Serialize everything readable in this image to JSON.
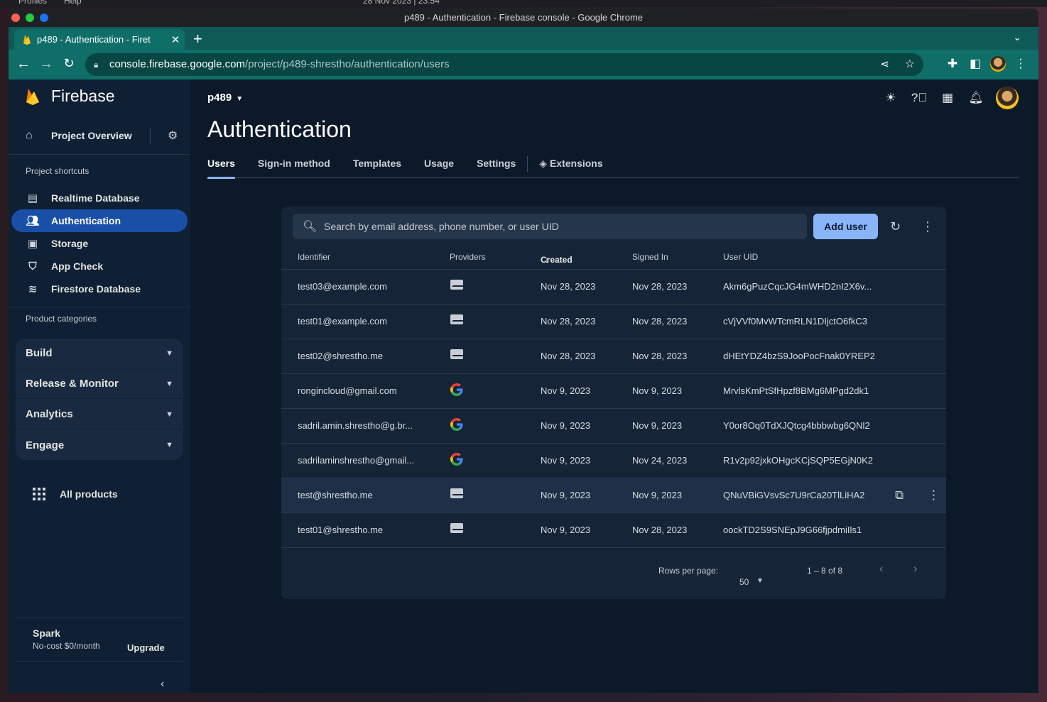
{
  "os": {
    "menu_left": "Profiles",
    "menu_help": "Help",
    "clock": "28 Nov 2023 | 23:54"
  },
  "window": {
    "title": "p489 - Authentication - Firebase console - Google Chrome"
  },
  "browser": {
    "tab_title": "p489 - Authentication - Firet",
    "url_host": "console.firebase.google.com",
    "url_path": "/project/p489-shrestho/authentication/users"
  },
  "sidebar": {
    "brand": "Firebase",
    "overview": "Project Overview",
    "shortcuts_label": "Project shortcuts",
    "shortcuts": [
      {
        "label": "Realtime Database",
        "icon": "database-icon"
      },
      {
        "label": "Authentication",
        "icon": "people-icon",
        "active": true
      },
      {
        "label": "Storage",
        "icon": "image-icon"
      },
      {
        "label": "App Check",
        "icon": "shield-icon"
      },
      {
        "label": "Firestore Database",
        "icon": "firestore-icon"
      }
    ],
    "categories_label": "Product categories",
    "categories": [
      "Build",
      "Release & Monitor",
      "Analytics",
      "Engage"
    ],
    "all_products": "All products",
    "plan_name": "Spark",
    "plan_desc": "No-cost $0/month",
    "upgrade": "Upgrade"
  },
  "header": {
    "project": "p489",
    "title": "Authentication"
  },
  "tabs": [
    "Users",
    "Sign-in method",
    "Templates",
    "Usage",
    "Settings",
    "Extensions"
  ],
  "users_card": {
    "search_placeholder": "Search by email address, phone number, or user UID",
    "add_user": "Add user",
    "columns": [
      "Identifier",
      "Providers",
      "Created",
      "Signed In",
      "User UID"
    ],
    "rows": [
      {
        "identifier": "test03@example.com",
        "provider": "email",
        "created": "Nov 28, 2023",
        "signed_in": "Nov 28, 2023",
        "uid": "Akm6gPuzCqcJG4mWHD2nI2X6v..."
      },
      {
        "identifier": "test01@example.com",
        "provider": "email",
        "created": "Nov 28, 2023",
        "signed_in": "Nov 28, 2023",
        "uid": "cVjVVf0MvWTcmRLN1DIjctO6fkC3"
      },
      {
        "identifier": "test02@shrestho.me",
        "provider": "email",
        "created": "Nov 28, 2023",
        "signed_in": "Nov 28, 2023",
        "uid": "dHEtYDZ4bzS9JooPocFnak0YREP2"
      },
      {
        "identifier": "rongincloud@gmail.com",
        "provider": "google",
        "created": "Nov 9, 2023",
        "signed_in": "Nov 9, 2023",
        "uid": "MrvlsKmPtSfHpzf8BMg6MPgd2dk1"
      },
      {
        "identifier": "sadril.amin.shrestho@g.br...",
        "provider": "google",
        "created": "Nov 9, 2023",
        "signed_in": "Nov 9, 2023",
        "uid": "Y0or8Oq0TdXJQtcg4bbbwbg6QNl2"
      },
      {
        "identifier": "sadrilaminshrestho@gmail...",
        "provider": "google",
        "created": "Nov 9, 2023",
        "signed_in": "Nov 24, 2023",
        "uid": "R1v2p92jxkOHgcKCjSQP5EGjN0K2"
      },
      {
        "identifier": "test@shrestho.me",
        "provider": "email",
        "created": "Nov 9, 2023",
        "signed_in": "Nov 9, 2023",
        "uid": "QNuVBiGVsvSc7U9rCa20TlLiHA2",
        "hovered": true
      },
      {
        "identifier": "test01@shrestho.me",
        "provider": "email",
        "created": "Nov 9, 2023",
        "signed_in": "Nov 28, 2023",
        "uid": "oockTD2S9SNEpJ9G66fjpdmiIls1"
      }
    ],
    "rows_per_page_label": "Rows per page:",
    "rows_per_page": "50",
    "range": "1 – 8 of 8"
  },
  "colors": {
    "accent": "#8ab4f8",
    "active_nav": "#1a4fa8",
    "chrome_toolbar": "#0f6e68"
  }
}
